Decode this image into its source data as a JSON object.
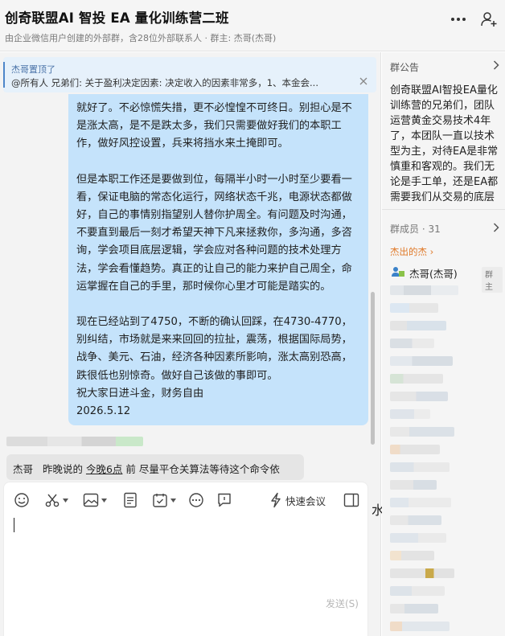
{
  "header": {
    "title": "创奇联盟AI 智投 EA 量化训练营二班",
    "subtitle": "由企业微信用户创建的外部群，含28位外部联系人 · 群主: 杰哥(杰哥)"
  },
  "pinned": {
    "label": "杰哥置顶了",
    "text": "@所有人 兄弟们:  关于盈利决定因素: 决定收入的因素非常多，1、本金会..."
  },
  "message": {
    "para1": "就好了。不必惊慌失措，更不必惶惶不可终日。别担心是不是涨太高，是不是跌太多，我们只需要做好我们的本职工作，做好风控设置，兵来将挡水来土掩即可。",
    "para2": "但是本职工作还是要做到位，每隔半小时一小时至少要看一看，保证电脑的常态化运行，网络状态千兆，电源状态都做好，自己的事情别指望别人替你护周全。有问题及时沟通，不要直到最后一刻才希望天神下凡来拯救你，多沟通，多咨询，学会项目底层逻辑，学会应对各种问题的技术处理方法，学会看懂趋势。真正的让自己的能力来护自己周全，命运掌握在自己的手里，那时候你心里才可能是踏实的。",
    "para3": "现在已经站到了4750，不断的确认回踩，在4730-4770，别纠结，市场就是来来回回的拉扯，震荡，根据国际局势，战争、美元、石油，经济各种因素所影响，涨太高别恐高，跌很低也别惊奇。做好自己该做的事即可。",
    "para4": "祝大家日进斗金，财务自由",
    "date": "2026.5.12"
  },
  "quote": {
    "name": "杰哥",
    "prefix": "昨晚说的",
    "link": "今晚6点",
    "suffix": "前  尽量平仓关算法等待这个命令依"
  },
  "toolbar": {
    "meeting_label": "快速会议"
  },
  "input": {
    "send_label": "发送(S)"
  },
  "watermark": "水印测试",
  "sidebar": {
    "notice_title": "群公告",
    "notice_text": "创奇联盟AI智投EA量化训练营的兄弟们，团队运营黄金交易技术4年了，本团队一直以技术型为主，对待EA是非常慎重和客观的。我们无论是手工单，还是EA都需要我们从交易的底层逻辑出发",
    "members_title": "群成员 · 31",
    "top_member": "杰出的杰 ›",
    "owner_name": "杰哥(杰哥)",
    "owner_role": "群主"
  },
  "colors": {
    "bubble": "#c5e3fb",
    "pinned_bg": "#e6f1fb",
    "accent_orange": "#e07a2a"
  }
}
